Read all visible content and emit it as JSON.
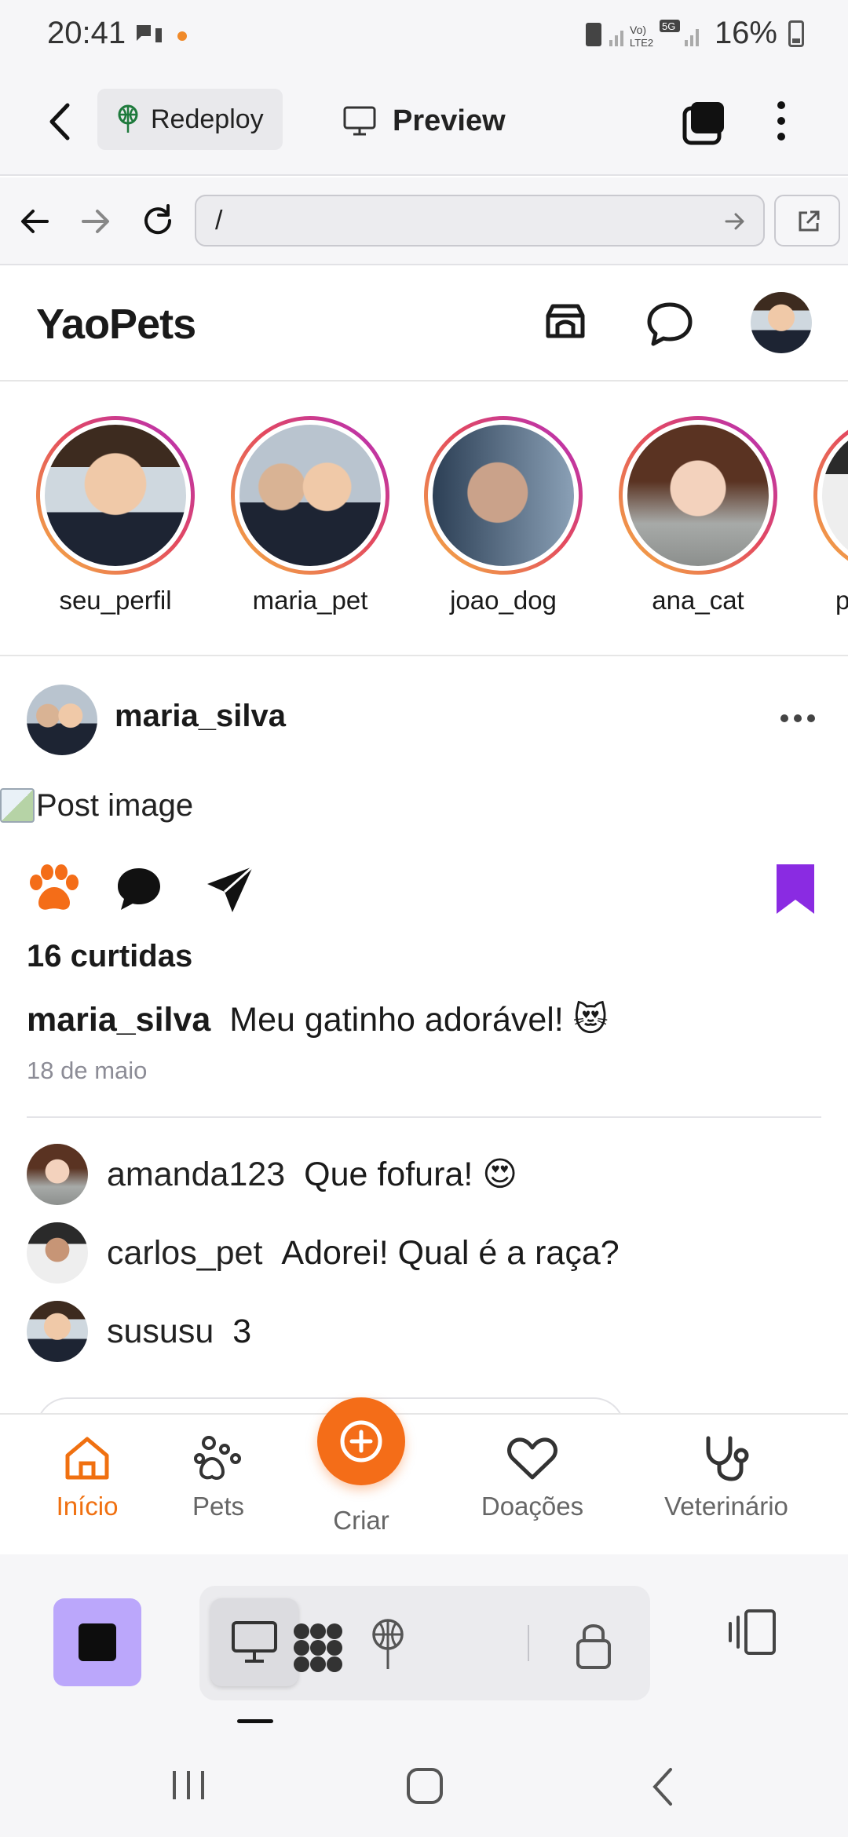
{
  "status_bar": {
    "time": "20:41",
    "battery": "16%"
  },
  "app_bar": {
    "redeploy_label": "Redeploy",
    "preview_label": "Preview"
  },
  "browser": {
    "url": "/"
  },
  "header": {
    "logo": "YaoPets"
  },
  "stories": [
    {
      "label": "seu_perfil"
    },
    {
      "label": "maria_pet"
    },
    {
      "label": "joao_dog"
    },
    {
      "label": "ana_cat"
    },
    {
      "label": "p"
    }
  ],
  "post": {
    "username": "maria_silva",
    "image_alt": "Post image",
    "likes": "16 curtidas",
    "caption_user": "maria_silva",
    "caption_text": "Meu gatinho adorável! 😻",
    "date": "18 de maio",
    "comments": [
      {
        "user": "amanda123",
        "text": "Que fofura! 😍"
      },
      {
        "user": "carlos_pet",
        "text": "Adorei! Qual é a raça?"
      },
      {
        "user": "sususu",
        "text": "3"
      }
    ]
  },
  "bottom_nav": {
    "items": [
      {
        "label": "Início"
      },
      {
        "label": "Pets"
      },
      {
        "label": "Criar"
      },
      {
        "label": "Doações"
      },
      {
        "label": "Veterinário"
      }
    ]
  },
  "colors": {
    "accent_orange": "#f46d18",
    "bookmark_purple": "#8a2be2",
    "stop_button": "#bba7fb"
  }
}
